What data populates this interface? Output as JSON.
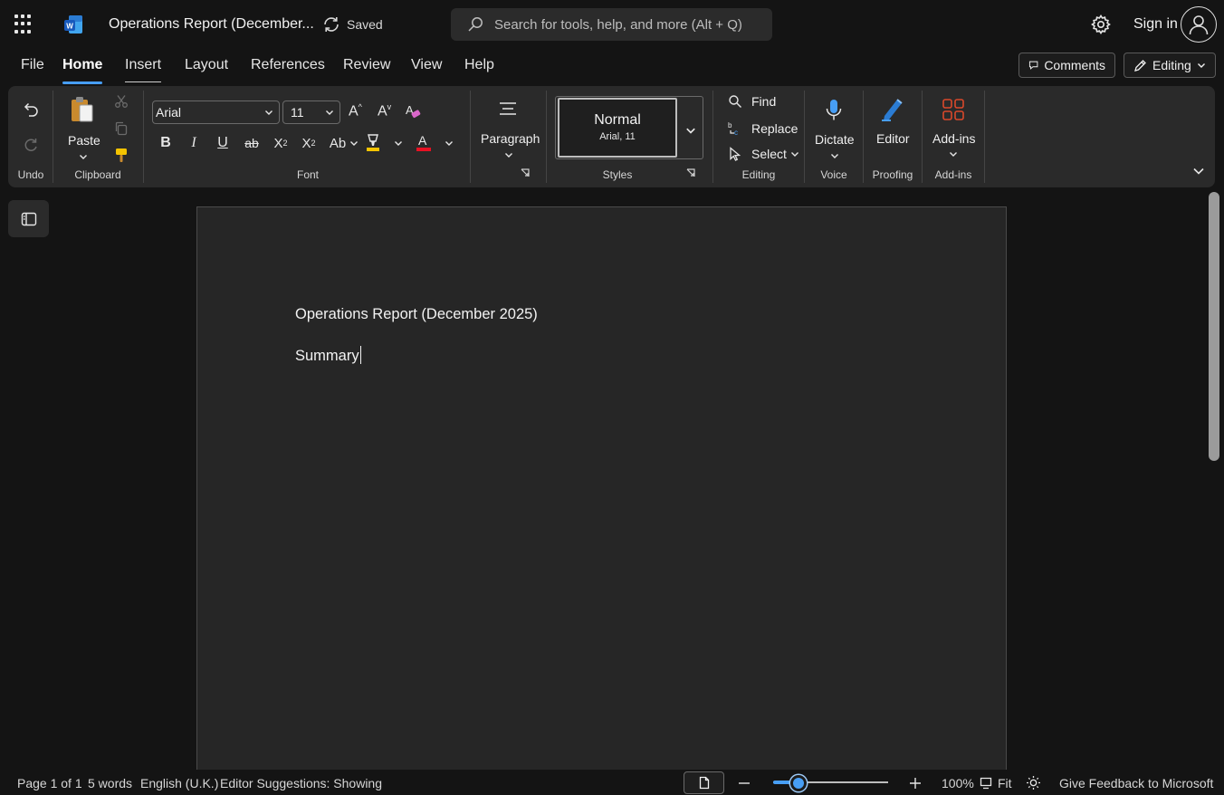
{
  "app": {
    "document_title": "Operations Report (December...",
    "save_status": "Saved",
    "search_placeholder": "Search for tools, help, and more (Alt + Q)",
    "sign_in_label": "Sign in"
  },
  "menu": {
    "tabs": [
      {
        "label": "File"
      },
      {
        "label": "Home"
      },
      {
        "label": "Insert"
      },
      {
        "label": "Layout"
      },
      {
        "label": "References"
      },
      {
        "label": "Review"
      },
      {
        "label": "View"
      },
      {
        "label": "Help"
      }
    ],
    "active_tab": "Home",
    "comments_label": "Comments",
    "editing_label": "Editing"
  },
  "ribbon": {
    "undo_group_label": "Undo",
    "clipboard": {
      "paste_label": "Paste",
      "group_label": "Clipboard"
    },
    "font": {
      "family": "Arial",
      "size": "11",
      "group_label": "Font",
      "font_color": "#e81123",
      "highlight_color": "#f5c400"
    },
    "paragraph": {
      "label": "Paragraph"
    },
    "styles": {
      "current_name": "Normal",
      "current_detail": "Arial, 11",
      "group_label": "Styles"
    },
    "editing": {
      "find_label": "Find",
      "replace_label": "Replace",
      "select_label": "Select",
      "group_label": "Editing"
    },
    "voice": {
      "dictate_label": "Dictate",
      "group_label": "Voice"
    },
    "proofing": {
      "editor_label": "Editor",
      "group_label": "Proofing"
    },
    "addins": {
      "label": "Add-ins",
      "group_label": "Add-ins"
    }
  },
  "document": {
    "lines": [
      "Operations Report (December 2025)",
      "Summary"
    ]
  },
  "statusbar": {
    "page": "Page 1 of 1",
    "words": "5 words",
    "language": "English (U.K.)",
    "editor_suggestions": "Editor Suggestions: Showing",
    "zoom": "100%",
    "fit_label": "Fit",
    "feedback": "Give Feedback to Microsoft"
  },
  "colors": {
    "accent": "#479ef5",
    "word_blue": "#185abd"
  }
}
